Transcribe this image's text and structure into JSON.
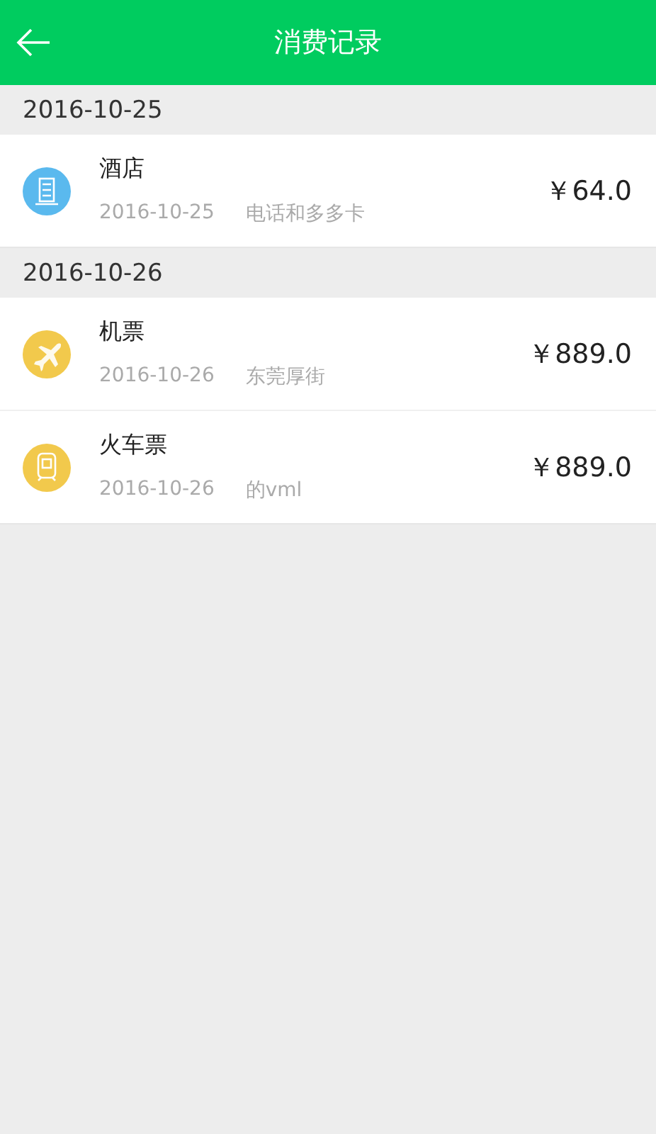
{
  "header": {
    "title": "消费记录"
  },
  "groups": [
    {
      "date": "2016-10-25",
      "records": [
        {
          "kind": "hotel",
          "name": "酒店",
          "date": "2016-10-25",
          "note": "电话和多多卡",
          "amount": "￥64.0"
        }
      ]
    },
    {
      "date": "2016-10-26",
      "records": [
        {
          "kind": "plane",
          "name": "机票",
          "date": "2016-10-26",
          "note": "东莞厚街",
          "amount": "￥889.0"
        },
        {
          "kind": "train",
          "name": "火车票",
          "date": "2016-10-26",
          "note": "的vml",
          "amount": "￥889.0"
        }
      ]
    }
  ]
}
